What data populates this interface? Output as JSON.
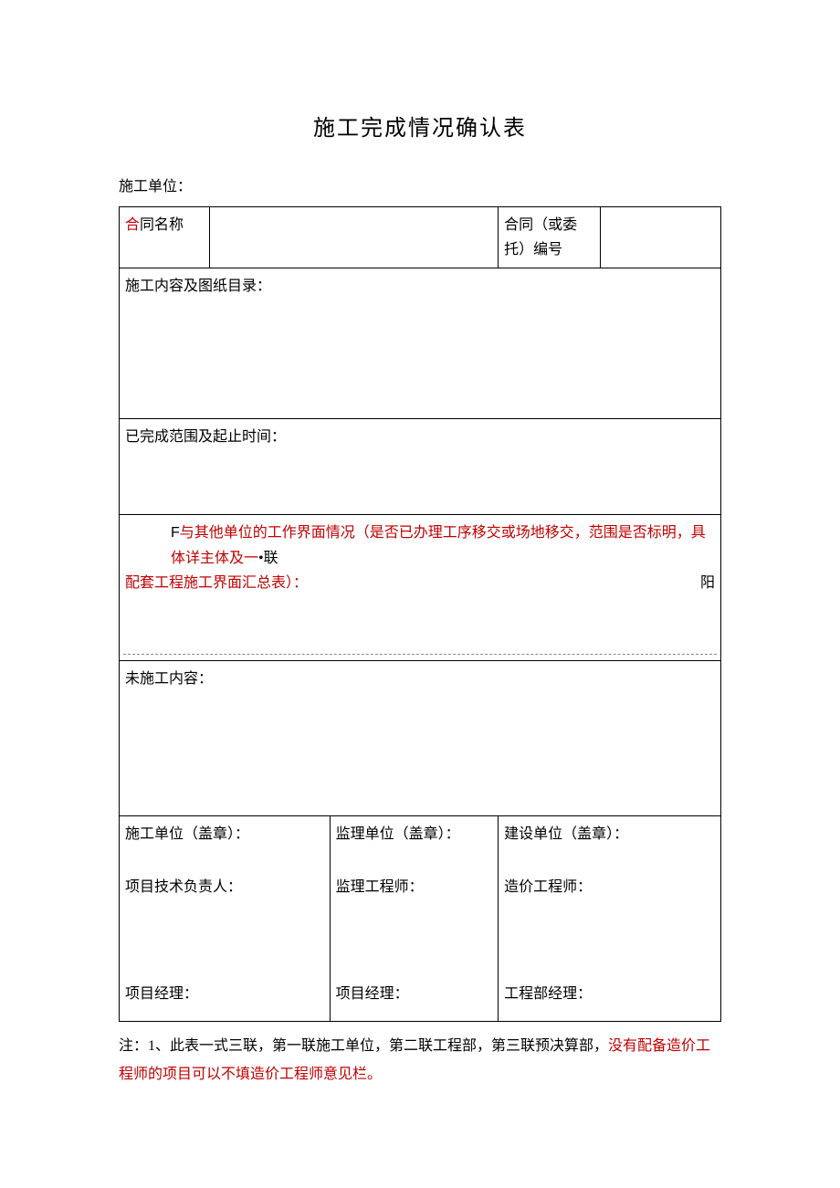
{
  "title": "施工完成情况确认表",
  "unit_label": "施工单位：",
  "row1": {
    "contract_name_prefix": "合",
    "contract_name_suffix": "同名称",
    "contract_no_label": "合同（或委托）编号"
  },
  "content_label": "施工内容及图纸目录：",
  "scope_label": "已完成范围及起止时间：",
  "interface": {
    "prefix": "F",
    "line1_black": "与其他单位的工作界面情况（是否已办理工序移交或场地移交，范围是否标明，具体详主体及一",
    "line1_end_black": "•联",
    "line2_red": "配套工程施工界面汇总表）：",
    "side_char": "阳"
  },
  "unconstructed_label": "未施工内容：",
  "signatures": {
    "col1": {
      "seal": "施工单位（盖章）：",
      "engineer": "项目技术负责人：",
      "manager": "项目经理："
    },
    "col2": {
      "seal": "监理单位（盖章）：",
      "engineer": "监理工程师：",
      "manager": "项目经理："
    },
    "col3": {
      "seal": "建设单位（盖章）：",
      "engineer": "造价工程师：",
      "manager": "工程部经理："
    }
  },
  "note": {
    "black": "注：1、此表一式三联，第一联施工单位，第二联工程部，第三联预决算部，",
    "red": "没有配备造价工程师的项目可以不填造价工程师意见栏。"
  }
}
